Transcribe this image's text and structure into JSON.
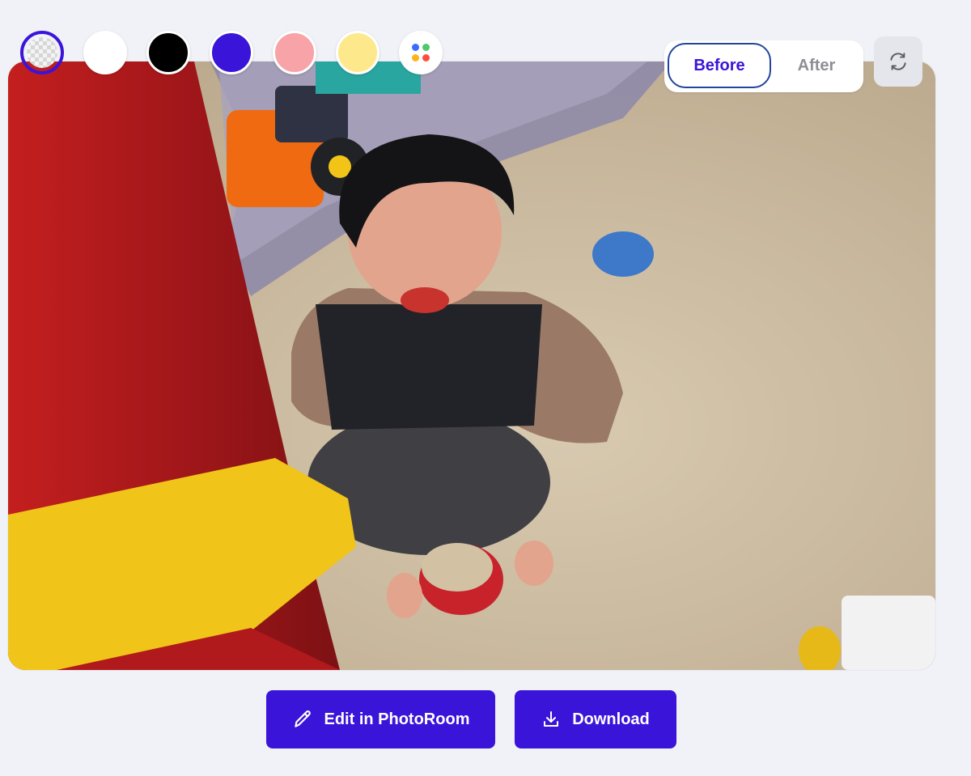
{
  "background_options": [
    {
      "name": "transparent",
      "type": "checker",
      "selected": true
    },
    {
      "name": "white",
      "color": "#ffffff"
    },
    {
      "name": "black",
      "color": "#000000"
    },
    {
      "name": "indigo",
      "color": "#3b14d9"
    },
    {
      "name": "pink",
      "color": "#f8a3a8"
    },
    {
      "name": "yellow",
      "color": "#fde98c"
    },
    {
      "name": "more-colors",
      "type": "palette",
      "dot_colors": [
        "#3b6cff",
        "#4fc96a",
        "#ffb21a",
        "#ff4d3d"
      ]
    }
  ],
  "view_toggle": {
    "before_label": "Before",
    "after_label": "After",
    "selected": "Before"
  },
  "reset_button": {
    "icon": "rotate-icon"
  },
  "actions": {
    "edit_label": "Edit in PhotoRoom",
    "download_label": "Download"
  },
  "colors": {
    "accent": "#3b14d9",
    "page_bg": "#f1f2f7"
  }
}
